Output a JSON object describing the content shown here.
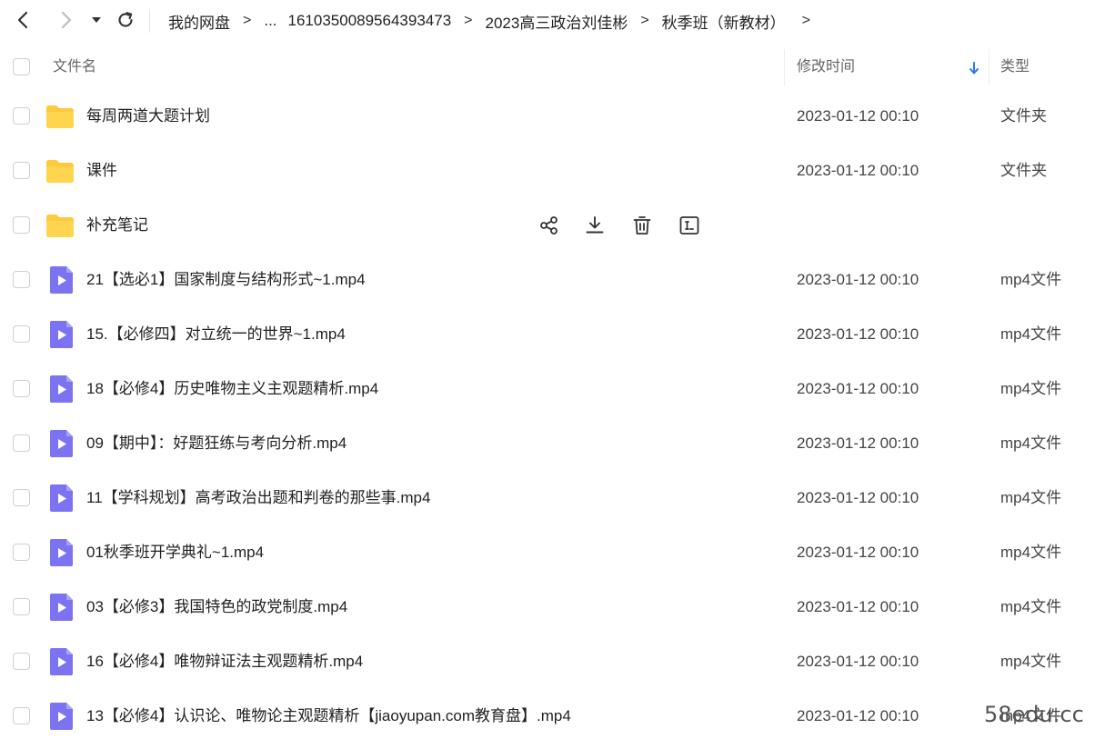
{
  "breadcrumb": {
    "items": [
      "我的网盘",
      "...",
      "1610350089564393473",
      "2023高三政治刘佳彬",
      "秋季班（新教材）"
    ],
    "separator": ">"
  },
  "header": {
    "name_label": "文件名",
    "time_label": "修改时间",
    "type_label": "类型"
  },
  "files": [
    {
      "name": "每周两道大题计划",
      "time": "2023-01-12 00:10",
      "type": "文件夹",
      "icon": "folder-icon"
    },
    {
      "name": "课件",
      "time": "2023-01-12 00:10",
      "type": "文件夹",
      "icon": "folder-icon"
    },
    {
      "name": "补充笔记",
      "time": "",
      "type": "",
      "icon": "folder-icon"
    },
    {
      "name": "21【选必1】国家制度与结构形式~1.mp4",
      "time": "2023-01-12 00:10",
      "type": "mp4文件",
      "icon": "video-file-icon"
    },
    {
      "name": "15.【必修四】对立统一的世界~1.mp4",
      "time": "2023-01-12 00:10",
      "type": "mp4文件",
      "icon": "video-file-icon"
    },
    {
      "name": "18【必修4】历史唯物主义主观题精析.mp4",
      "time": "2023-01-12 00:10",
      "type": "mp4文件",
      "icon": "video-file-icon"
    },
    {
      "name": "09【期中】：好题狂练与考向分析.mp4",
      "time": "2023-01-12 00:10",
      "type": "mp4文件",
      "icon": "video-file-icon"
    },
    {
      "name": "11【学科规划】高考政治出题和判卷的那些事.mp4",
      "time": "2023-01-12 00:10",
      "type": "mp4文件",
      "icon": "video-file-icon"
    },
    {
      "name": "01秋季班开学典礼~1.mp4",
      "time": "2023-01-12 00:10",
      "type": "mp4文件",
      "icon": "video-file-icon"
    },
    {
      "name": "03【必修3】我国特色的政党制度.mp4",
      "time": "2023-01-12 00:10",
      "type": "mp4文件",
      "icon": "video-file-icon"
    },
    {
      "name": "16【必修4】唯物辩证法主观题精析.mp4",
      "time": "2023-01-12 00:10",
      "type": "mp4文件",
      "icon": "video-file-icon"
    },
    {
      "name": "13【必修4】认识论、唯物论主观题精析【jiaoyupan.com教育盘】.mp4",
      "time": "2023-01-12 00:10",
      "type": "mp4文件",
      "icon": "video-file-icon"
    }
  ],
  "hover_actions": [
    "share-icon",
    "download-icon",
    "delete-icon",
    "rename-icon"
  ],
  "watermark": "58edu.cc",
  "colors": {
    "folder": "#FFC93C",
    "video": "#7B73F2",
    "sort_arrow": "#2B7BE6"
  }
}
